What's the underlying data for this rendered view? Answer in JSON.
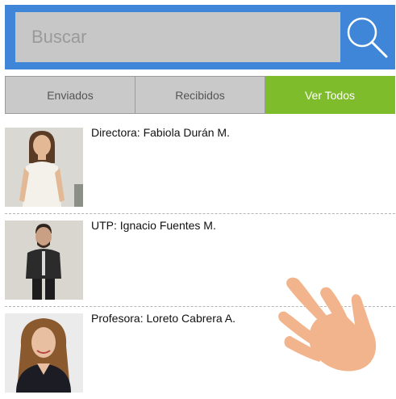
{
  "search": {
    "placeholder": "Buscar",
    "value": ""
  },
  "tabs": [
    {
      "label": "Enviados",
      "active": false
    },
    {
      "label": "Recibidos",
      "active": false
    },
    {
      "label": "Ver Todos",
      "active": true
    }
  ],
  "contacts": [
    {
      "label": "Directora: Fabiola Durán M."
    },
    {
      "label": "UTP: Ignacio Fuentes M."
    },
    {
      "label": "Profesora: Loreto Cabrera A."
    }
  ],
  "colors": {
    "search_bar_bg": "#3f86d9",
    "search_input_bg": "#c7c7c7",
    "tab_bg": "#c9c9c9",
    "tab_active_bg": "#7ebc2c",
    "hand_fill": "#f2b48c"
  },
  "icons": {
    "search": "search-icon",
    "hand": "hand-pointer-icon"
  }
}
